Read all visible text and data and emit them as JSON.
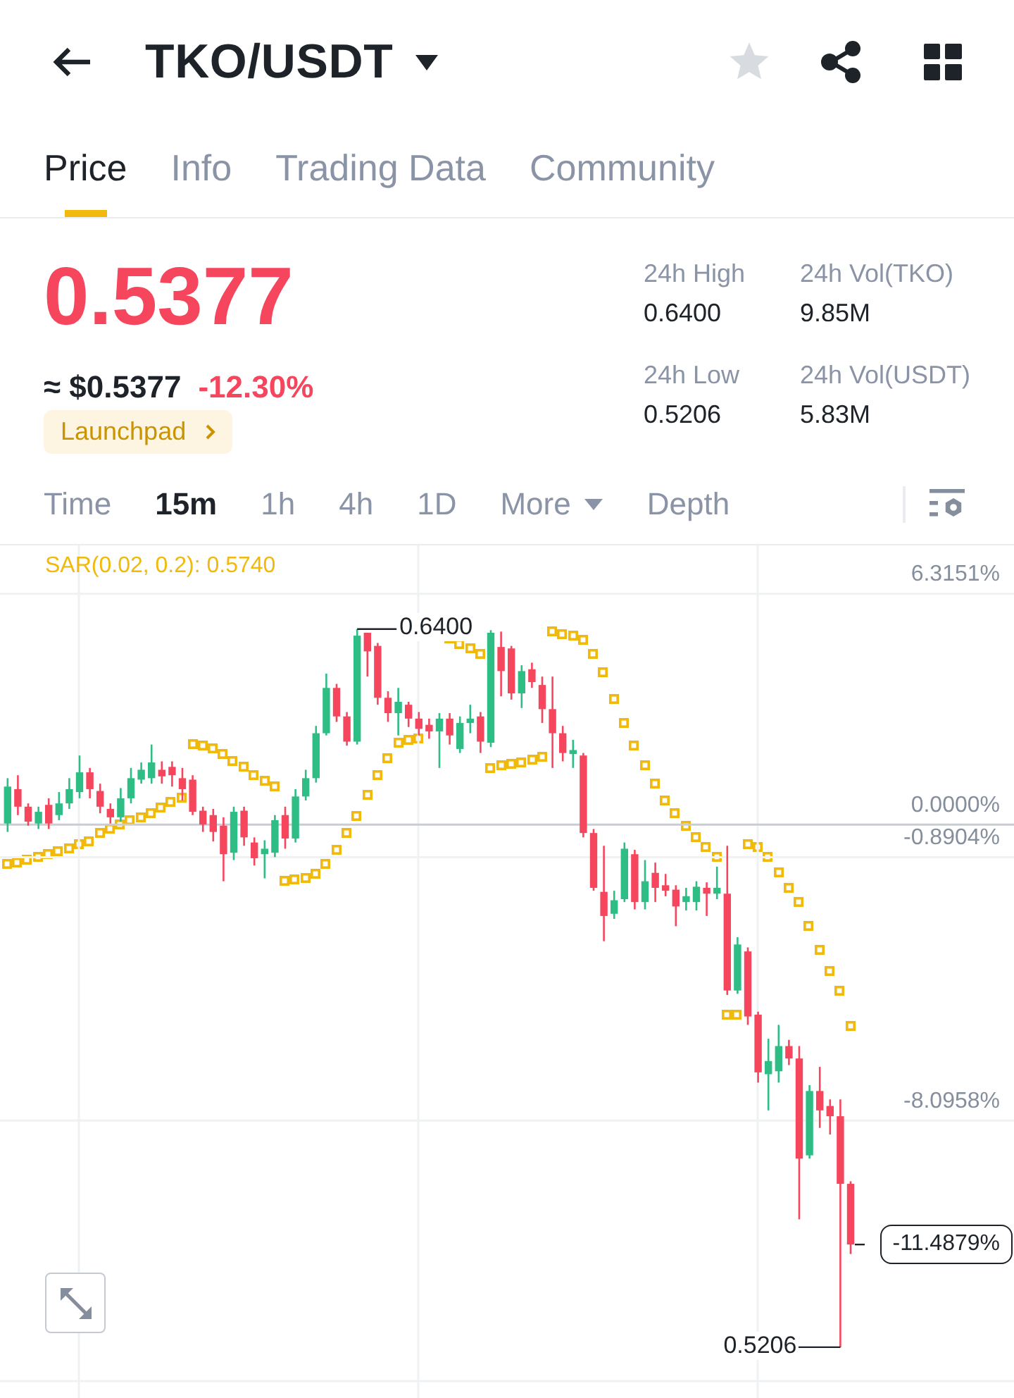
{
  "header": {
    "title": "TKO/USDT",
    "favorite": false
  },
  "tabs": [
    {
      "label": "Price",
      "selected": true
    },
    {
      "label": "Info",
      "selected": false
    },
    {
      "label": "Trading Data",
      "selected": false
    },
    {
      "label": "Community",
      "selected": false
    }
  ],
  "price": {
    "last": "0.5377",
    "fiat": "≈ $0.5377",
    "change": "-12.30%",
    "badge": "Launchpad"
  },
  "stats": [
    {
      "label": "24h High",
      "value": "0.6400"
    },
    {
      "label": "24h Vol(TKO)",
      "value": "9.85M"
    },
    {
      "label": "24h Low",
      "value": "0.5206"
    },
    {
      "label": "24h Vol(USDT)",
      "value": "5.83M"
    }
  ],
  "intervals": [
    {
      "label": "Time",
      "kind": "option",
      "selected": false
    },
    {
      "label": "15m",
      "kind": "option",
      "selected": true
    },
    {
      "label": "1h",
      "kind": "option",
      "selected": false
    },
    {
      "label": "4h",
      "kind": "option",
      "selected": false
    },
    {
      "label": "1D",
      "kind": "option",
      "selected": false
    },
    {
      "label": "More",
      "kind": "menu",
      "selected": false
    },
    {
      "label": "Depth",
      "kind": "option",
      "selected": false
    }
  ],
  "chart": {
    "indicator": "SAR(0.02, 0.2): 0.5740",
    "current_label": "-11.4879%",
    "chart_data": {
      "type": "candlestick",
      "categories": [
        null,
        null,
        null,
        null,
        null,
        null,
        null,
        null,
        null,
        null,
        null,
        null,
        null,
        null,
        null,
        null,
        null,
        null,
        null,
        null,
        null,
        null,
        null,
        null,
        null,
        null,
        null,
        null,
        null,
        null,
        null,
        null,
        null,
        null,
        null,
        null,
        null,
        null,
        null,
        null,
        null,
        null,
        null,
        null,
        null,
        null,
        null,
        null,
        null,
        null,
        null,
        null,
        null,
        null,
        null,
        null,
        null,
        null,
        null,
        null,
        null,
        null,
        null,
        null,
        null,
        null,
        null,
        null,
        null,
        null,
        null,
        null,
        null,
        null,
        null,
        null,
        null,
        null,
        null,
        null,
        null,
        null,
        null
      ],
      "ohlc": [
        [
          0.03,
          1.27,
          -0.2,
          1.04
        ],
        [
          0.97,
          1.35,
          0.26,
          0.49
        ],
        [
          0.49,
          0.58,
          -0.03,
          0.08
        ],
        [
          0.03,
          0.49,
          -0.12,
          0.35
        ],
        [
          0.54,
          0.72,
          -0.12,
          0.03
        ],
        [
          0.26,
          0.89,
          0.12,
          0.58
        ],
        [
          0.58,
          1.27,
          0.43,
          0.97
        ],
        [
          0.89,
          1.89,
          0.72,
          1.43
        ],
        [
          1.43,
          1.55,
          0.72,
          0.97
        ],
        [
          0.92,
          1.12,
          0.31,
          0.49
        ],
        [
          0.43,
          0.58,
          0.03,
          0.2
        ],
        [
          0.2,
          1.0,
          0.08,
          0.72
        ],
        [
          0.72,
          1.55,
          0.58,
          1.27
        ],
        [
          1.23,
          1.7,
          1.12,
          1.5
        ],
        [
          1.27,
          2.19,
          1.12,
          1.7
        ],
        [
          1.5,
          1.73,
          1.12,
          1.32
        ],
        [
          1.58,
          1.73,
          1.04,
          1.35
        ],
        [
          1.27,
          1.55,
          0.66,
          0.97
        ],
        [
          1.23,
          1.35,
          0.26,
          0.35
        ],
        [
          0.38,
          0.49,
          -0.2,
          0.0
        ],
        [
          0.26,
          0.43,
          -0.46,
          -0.2
        ],
        [
          -0.03,
          0.2,
          -1.55,
          -0.81
        ],
        [
          -0.77,
          0.49,
          -0.97,
          0.35
        ],
        [
          0.38,
          0.49,
          -0.58,
          -0.35
        ],
        [
          -0.49,
          -0.35,
          -1.12,
          -0.92
        ],
        [
          -0.81,
          -0.43,
          -1.47,
          -0.66
        ],
        [
          -0.77,
          0.26,
          -0.89,
          0.12
        ],
        [
          0.26,
          0.49,
          -0.66,
          -0.38
        ],
        [
          -0.38,
          0.97,
          -0.49,
          0.77
        ],
        [
          0.77,
          1.5,
          0.66,
          1.27
        ],
        [
          1.27,
          2.7,
          1.15,
          2.5
        ],
        [
          2.5,
          4.13,
          2.44,
          3.74
        ],
        [
          3.74,
          3.85,
          2.81,
          2.96
        ],
        [
          2.96,
          3.08,
          2.16,
          2.27
        ],
        [
          2.27,
          5.35,
          2.19,
          5.17
        ],
        [
          5.25,
          5.25,
          4.05,
          4.74
        ],
        [
          4.89,
          4.97,
          3.28,
          3.47
        ],
        [
          3.47,
          3.65,
          2.81,
          3.05
        ],
        [
          3.05,
          3.74,
          2.44,
          3.36
        ],
        [
          3.28,
          3.36,
          2.67,
          2.9
        ],
        [
          2.9,
          3.08,
          2.44,
          2.62
        ],
        [
          2.73,
          2.9,
          2.35,
          2.55
        ],
        [
          2.55,
          3.05,
          1.55,
          2.9
        ],
        [
          2.9,
          3.05,
          2.19,
          2.44
        ],
        [
          2.07,
          2.96,
          1.96,
          2.78
        ],
        [
          2.78,
          3.28,
          2.5,
          2.9
        ],
        [
          2.96,
          3.08,
          1.96,
          2.27
        ],
        [
          2.24,
          5.32,
          2.12,
          5.25
        ],
        [
          4.86,
          5.28,
          3.51,
          4.2
        ],
        [
          4.82,
          4.89,
          3.42,
          3.59
        ],
        [
          3.59,
          4.36,
          3.19,
          4.2
        ],
        [
          4.25,
          4.43,
          3.74,
          3.9
        ],
        [
          3.82,
          4.05,
          2.78,
          3.16
        ],
        [
          3.16,
          4.05,
          1.55,
          2.5
        ],
        [
          2.5,
          2.7,
          1.73,
          1.96
        ],
        [
          1.93,
          2.32,
          1.55,
          2.04
        ],
        [
          1.89,
          1.96,
          -0.35,
          -0.23
        ],
        [
          -0.23,
          -0.12,
          -1.81,
          -1.73
        ],
        [
          -1.84,
          -0.58,
          -3.19,
          -2.5
        ],
        [
          -2.44,
          -1.81,
          -2.58,
          -2.07
        ],
        [
          -2.04,
          -0.49,
          -2.12,
          -0.66
        ],
        [
          -0.81,
          -0.69,
          -2.32,
          -2.12
        ],
        [
          -2.12,
          -0.97,
          -2.32,
          -1.55
        ],
        [
          -1.32,
          -1.04,
          -2.12,
          -1.73
        ],
        [
          -1.66,
          -1.35,
          -1.96,
          -1.81
        ],
        [
          -1.78,
          -1.66,
          -2.78,
          -2.24
        ],
        [
          -2.12,
          -1.73,
          -2.35,
          -1.96
        ],
        [
          -2.12,
          -1.55,
          -2.35,
          -1.7
        ],
        [
          -1.73,
          -1.58,
          -2.5,
          -1.89
        ],
        [
          -1.89,
          -1.15,
          -2.04,
          -1.73
        ],
        [
          -1.89,
          -0.58,
          -4.66,
          -4.54
        ],
        [
          -4.54,
          -3.08,
          -4.63,
          -3.28
        ],
        [
          -3.47,
          -3.36,
          -5.48,
          -5.25
        ],
        [
          -5.2,
          -5.12,
          -7.06,
          -6.78
        ],
        [
          -6.83,
          -5.86,
          -7.82,
          -6.47
        ],
        [
          -6.75,
          -5.48,
          -7.06,
          -6.06
        ],
        [
          -6.06,
          -5.89,
          -6.58,
          -6.4
        ],
        [
          -6.4,
          -6.06,
          -10.8,
          -9.14
        ],
        [
          -9.05,
          -7.13,
          -9.14,
          -7.29
        ],
        [
          -7.29,
          -6.63,
          -8.3,
          -7.82
        ],
        [
          -7.7,
          -7.52,
          -8.48,
          -7.98
        ],
        [
          -7.98,
          -7.52,
          -14.3,
          -9.83
        ],
        [
          -9.83,
          -9.76,
          -11.75,
          -11.49
        ]
      ],
      "ylim": [
        -15.69,
        7.64
      ],
      "yticks": [
        {
          "value": 6.3151,
          "label": "6.3151%"
        },
        {
          "value": 0,
          "label": "0.0000%"
        },
        {
          "value": -0.8904,
          "label": "-0.8904%"
        },
        {
          "value": -8.0958,
          "label": "-8.0958%"
        }
      ],
      "grid": true,
      "annotations": [
        "0.6400",
        "0.5206"
      ]
    }
  }
}
